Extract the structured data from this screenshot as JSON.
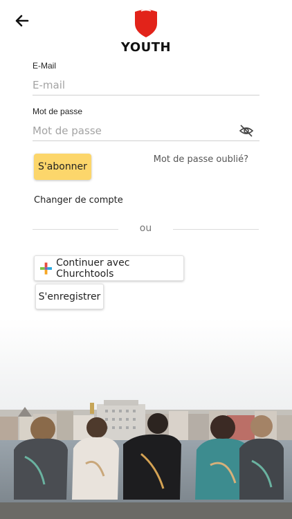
{
  "header": {
    "back_icon": "arrow-left-icon",
    "logo_icon": "shield-icon",
    "brand": "YOUTH"
  },
  "colors": {
    "accent": "#fcd66b",
    "shield": "#e2231a"
  },
  "email": {
    "label": "E-Mail",
    "placeholder": "E-mail",
    "value": ""
  },
  "password": {
    "label": "Mot de passe",
    "placeholder": "Mot de passe",
    "value": "",
    "toggle_icon": "eye-off-icon"
  },
  "actions": {
    "subscribe": "S'abonner",
    "forgot": "Mot de passe oublié?",
    "switch_account": "Changer de compte",
    "or": "ou",
    "churchtools": "Continuer avec Churchtools",
    "churchtools_icon": "churchtools-logo-icon",
    "register": "S'enregistrer"
  },
  "hero_image": "group-photo-riverside"
}
